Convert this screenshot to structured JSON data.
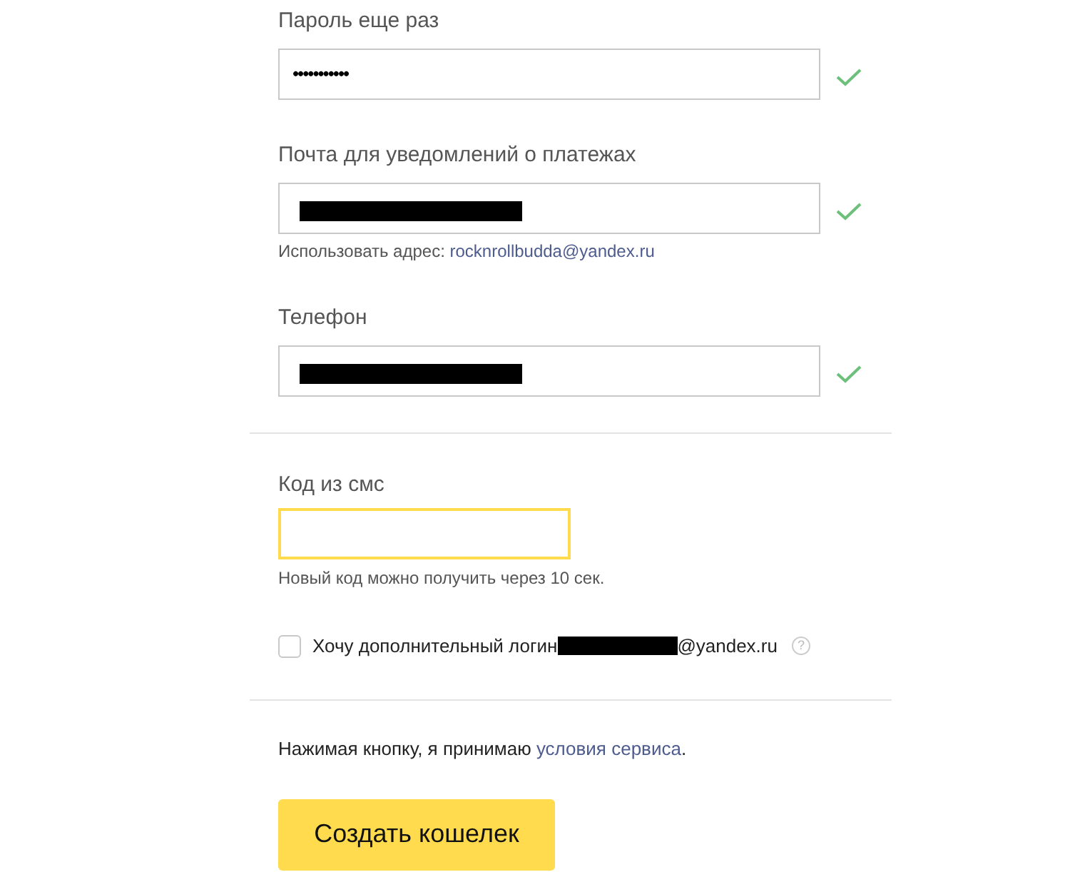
{
  "fields": [
    {
      "label": "Пароль еще раз",
      "kind": "password",
      "value": "•••••••••••",
      "valid": true
    },
    {
      "label": "Почта для уведомлений о платежах",
      "kind": "redacted",
      "valid": true,
      "hint": {
        "text": "Использовать адрес:",
        "link": "rocknrollbudda@yandex.ru"
      }
    },
    {
      "label": "Телефон",
      "kind": "redacted",
      "valid": true
    }
  ],
  "sms": {
    "label": "Код из смс",
    "focused": true,
    "hint": "Новый код можно получить через 10 сек."
  },
  "extra_login": {
    "checked": false,
    "text": "Хочу дополнительный логин",
    "suffix": "@yandex.ru",
    "help": "?"
  },
  "terms": {
    "text": "Нажимая кнопку, я принимаю",
    "link": "условия сервиса",
    "end": "."
  },
  "submit": {
    "label": "Создать кошелек"
  }
}
